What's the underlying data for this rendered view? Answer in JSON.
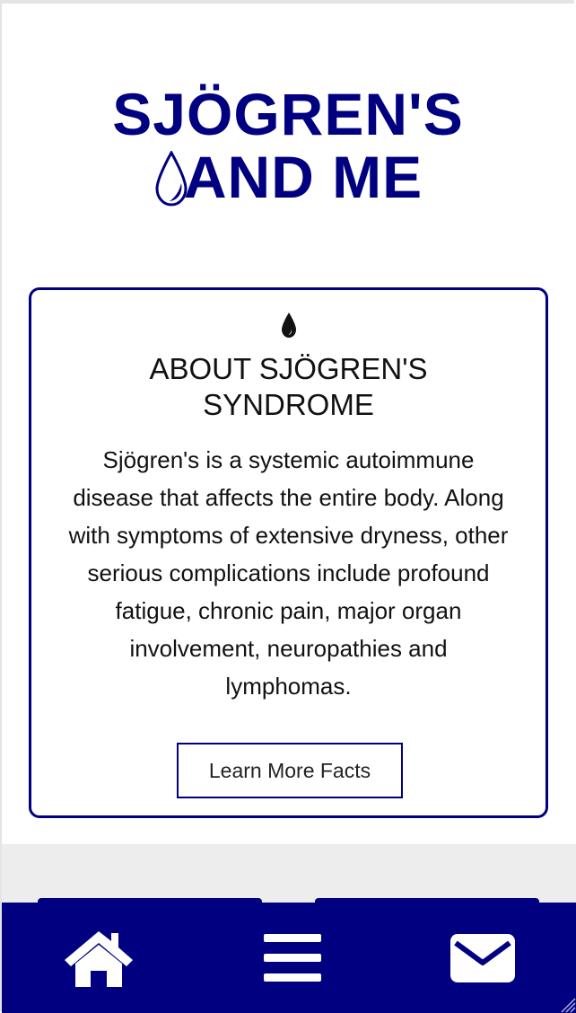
{
  "logo": {
    "line1": "SJÖGREN'S",
    "line2": "AND ME",
    "brand_color": "#000080"
  },
  "about_card": {
    "icon": "droplet-icon",
    "title_line1": "ABOUT SJÖGREN'S",
    "title_line2": "SYNDROME",
    "body": "Sjögren's is a systemic autoimmune disease that affects the entire body. Along with symptoms of extensive dryness, other serious complications include profound fatigue, chronic pain, major organ involvement, neuropathies and lymphomas.",
    "button_label": "Learn More Facts"
  },
  "bottom_nav": {
    "items": [
      {
        "icon": "home-icon"
      },
      {
        "icon": "menu-icon"
      },
      {
        "icon": "mail-icon"
      }
    ],
    "background_color": "#000080"
  }
}
